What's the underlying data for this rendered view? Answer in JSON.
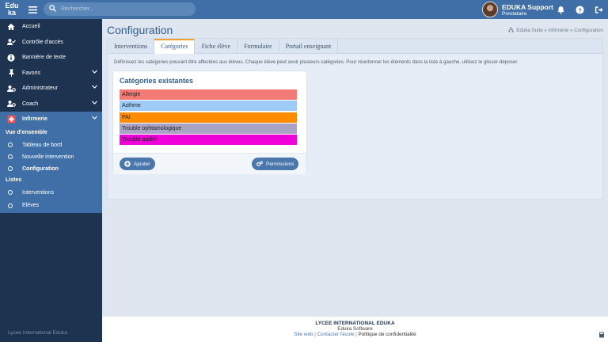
{
  "header": {
    "logo_top": "Edu",
    "logo_bottom": "ka",
    "search_placeholder": "Rechercher...",
    "user_name": "EDUKA Support",
    "user_role": "Prestataire"
  },
  "sidebar": {
    "items": [
      {
        "label": "Accueil",
        "icon": "home-icon"
      },
      {
        "label": "Contrôle d'accès",
        "icon": "user-check-icon"
      },
      {
        "label": "Bannière de texte",
        "icon": "info-icon"
      },
      {
        "label": "Favoris",
        "icon": "pin-icon"
      },
      {
        "label": "Administrateur",
        "icon": "user-gear-icon"
      },
      {
        "label": "Coach",
        "icon": "user-gear-icon"
      },
      {
        "label": "Infirmerie",
        "icon": "nurse-icon"
      }
    ],
    "section_overview": "Vue d'ensemble",
    "overview_items": [
      "Tableau de bord",
      "Nouvelle intervention",
      "Configuration"
    ],
    "section_lists": "Listes",
    "list_items": [
      "Interventions",
      "Elèves"
    ],
    "footer": "Lycee International Eduka"
  },
  "main": {
    "title": "Configuration",
    "breadcrumb": "Eduka Suite » Infirmerie » Configuration",
    "tabs": [
      "Interventions",
      "Catégories",
      "Fiche élève",
      "Formulaire",
      "Portail enseignant"
    ],
    "active_tab": "Catégories",
    "description": "Définissez les catégories pouvant être affectées aux élèves. Chaque élève peut avoir plusieurs catégories. Pour réordonner les éléments dans la liste à gauche, utilisez le glisser-déposer.",
    "categories_title": "Catégories existantes",
    "categories": [
      {
        "label": "Allergie",
        "color": "#f47a75"
      },
      {
        "label": "Asthme",
        "color": "#9ecbf7"
      },
      {
        "label": "PAI",
        "color": "#ff8c00"
      },
      {
        "label": "Trouble ophtamologique",
        "color": "#a9a3c6"
      },
      {
        "label": "Trouble auditif",
        "color": "#f000d8"
      }
    ],
    "add_button": "Ajouter",
    "permissions_button": "Permissions"
  },
  "footer": {
    "school": "LYCEE INTERNATIONAL EDUKA",
    "software": "Eduka Software",
    "link_site": "Site web",
    "link_contact": "Contacter l'école",
    "link_privacy": "Politique de confidentialité"
  },
  "colors": {
    "topbar": "#3f6fa6",
    "sidebar": "#1e3350",
    "accent": "#2f5d8c",
    "tab_highlight": "#f0a030"
  }
}
